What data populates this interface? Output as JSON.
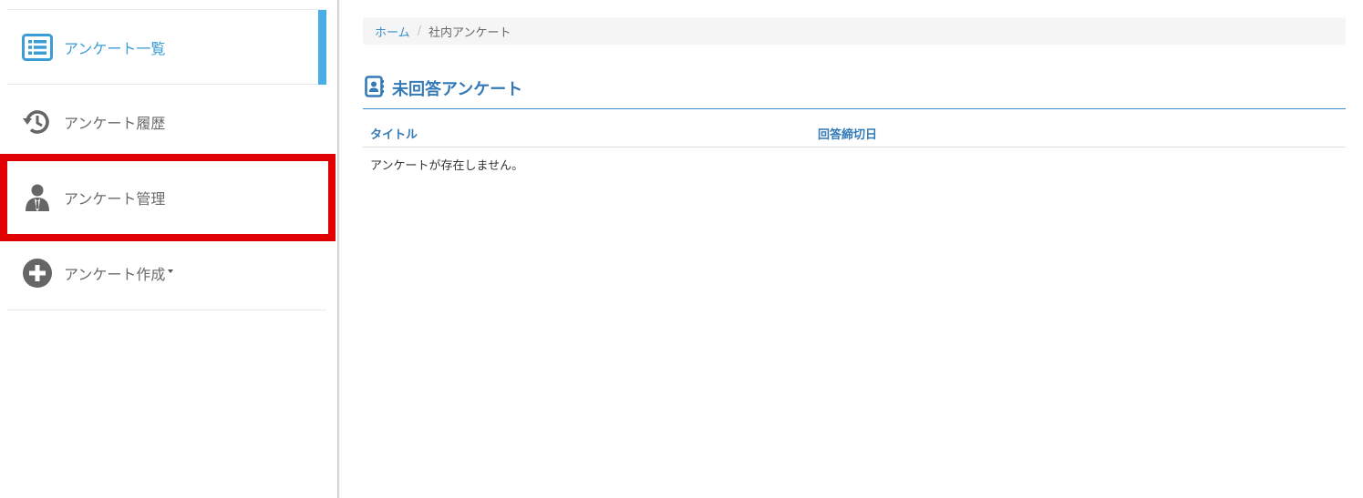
{
  "sidebar": {
    "items": [
      {
        "label": "アンケート一覧",
        "icon": "list-icon",
        "active": true
      },
      {
        "label": "アンケート履歴",
        "icon": "history-icon",
        "active": false
      },
      {
        "label": "アンケート管理",
        "icon": "user-manager-icon",
        "active": false,
        "highlighted": true
      },
      {
        "label": "アンケート作成",
        "icon": "plus-circle-icon",
        "active": false,
        "has_dropdown": true
      }
    ]
  },
  "breadcrumb": {
    "home": "ホーム",
    "separator": "/",
    "current": "社内アンケート"
  },
  "main": {
    "section_title": "未回答アンケート",
    "section_icon": "contact-book-icon",
    "table": {
      "columns": [
        "タイトル",
        "回答締切日"
      ],
      "empty_message": "アンケートが存在しません。"
    }
  },
  "colors": {
    "accent": "#3a9dd6",
    "active_bar": "#4aaee6",
    "highlight": "#e00000",
    "title_blue": "#337ab7"
  }
}
